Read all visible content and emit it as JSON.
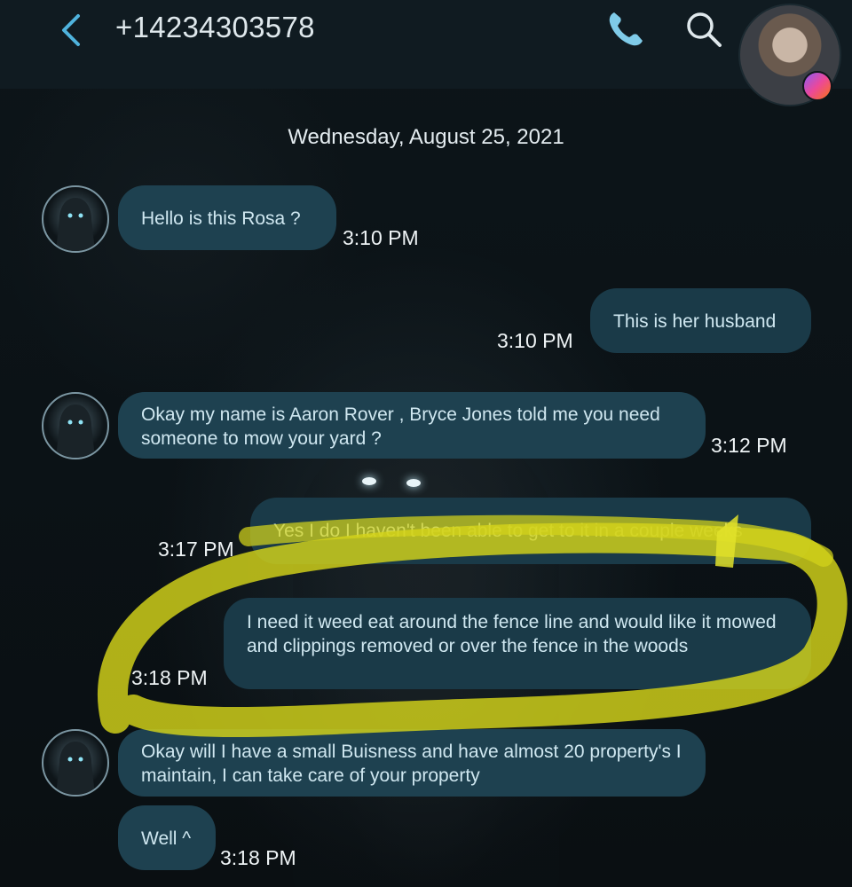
{
  "header": {
    "title": "+14234303578",
    "back_icon": "back-icon",
    "call_icon": "phone-icon",
    "search_icon": "search-icon",
    "profile_badge_icon": "messenger-icon"
  },
  "conversation": {
    "date": "Wednesday, August 25, 2021",
    "messages": [
      {
        "direction": "incoming",
        "text": "Hello is this Rosa ?",
        "time": "3:10 PM"
      },
      {
        "direction": "outgoing",
        "text": "This is her husband",
        "time": "3:10 PM"
      },
      {
        "direction": "incoming",
        "text": "Okay my name is Aaron Rover , Bryce Jones told me you need someone to mow your yard ?",
        "time": "3:12 PM"
      },
      {
        "direction": "outgoing",
        "text": "Yes I do I haven't been able to get to it in a couple weeks",
        "time": "3:17 PM"
      },
      {
        "direction": "outgoing",
        "text": "I need it weed eat around the fence line and would like it mowed and clippings removed or over the fence in the woods",
        "time": "3:18 PM"
      },
      {
        "direction": "incoming",
        "text": "Okay will I have a small Buisness and have almost 20 property's I maintain, I can take care of your property",
        "time": ""
      },
      {
        "direction": "incoming",
        "text": "Well ^",
        "time": "3:18 PM"
      }
    ]
  },
  "colors": {
    "header_bg": "#101b21",
    "bubble_incoming": "#1e4150",
    "bubble_outgoing": "#1a3a48",
    "accent": "#4fb3dd",
    "highlight": "#d4d41a"
  }
}
